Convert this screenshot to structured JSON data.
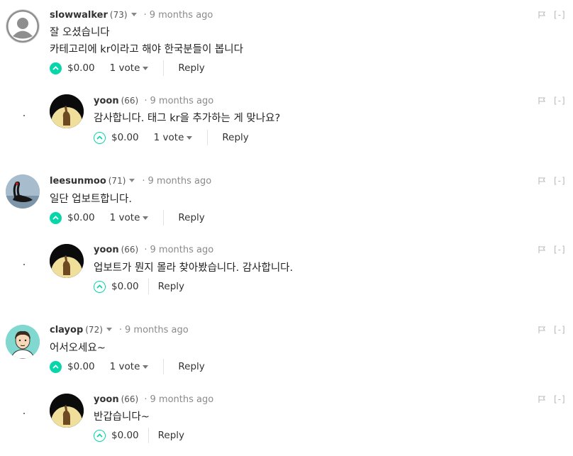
{
  "comments": [
    {
      "author": "slowwalker",
      "reputation": "(73)",
      "time": "9 months ago",
      "lines": [
        "잘 오셨습니다",
        "카테고리에 kr이라고 해야 한국분들이 봅니다"
      ],
      "payout": "$0.00",
      "votes": "1 vote",
      "reply": "Reply",
      "collapse": "[-]"
    },
    {
      "author": "yoon",
      "reputation": "(66)",
      "time": "9 months ago",
      "lines": [
        "감사합니다. 태그 kr을 추가하는 게 맞나요?"
      ],
      "payout": "$0.00",
      "votes": "1 vote",
      "reply": "Reply",
      "collapse": "[-]"
    },
    {
      "author": "leesunmoo",
      "reputation": "(71)",
      "time": "9 months ago",
      "lines": [
        "일단 업보트합니다."
      ],
      "payout": "$0.00",
      "votes": "1 vote",
      "reply": "Reply",
      "collapse": "[-]"
    },
    {
      "author": "yoon",
      "reputation": "(66)",
      "time": "9 months ago",
      "lines": [
        "업보트가 뭔지 몰라 찾아봤습니다. 감사합니다."
      ],
      "payout": "$0.00",
      "votes": "",
      "reply": "Reply",
      "collapse": "[-]"
    },
    {
      "author": "clayop",
      "reputation": "(72)",
      "time": "9 months ago",
      "lines": [
        "어서오세요~"
      ],
      "payout": "$0.00",
      "votes": "1 vote",
      "reply": "Reply",
      "collapse": "[-]"
    },
    {
      "author": "yoon",
      "reputation": "(66)",
      "time": "9 months ago",
      "lines": [
        "반갑습니다~"
      ],
      "payout": "$0.00",
      "votes": "",
      "reply": "Reply",
      "collapse": "[-]"
    }
  ],
  "colors": {
    "accent": "#06d6a9",
    "muted": "#8a8a8a"
  }
}
